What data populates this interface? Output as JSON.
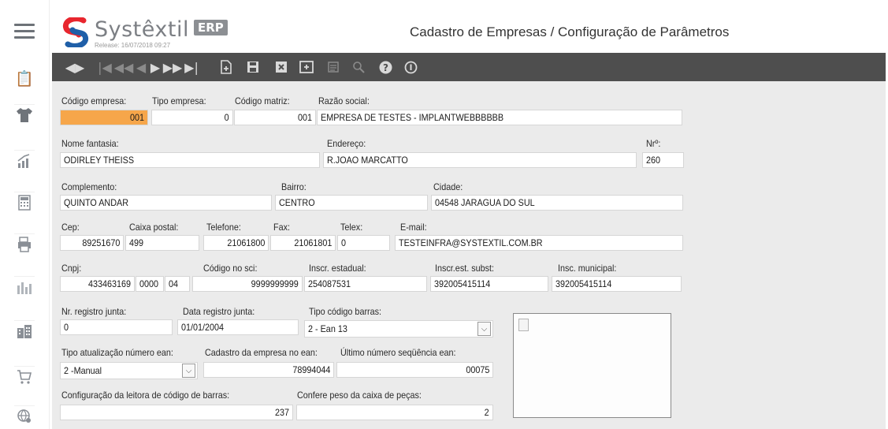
{
  "app": {
    "logo_text": "Systêxtil",
    "logo_badge": "ERP",
    "release": "Release: 16/07/2018 09:27",
    "page_title": "Cadastro de Empresas / Configuração de Parâmetros"
  },
  "sidebar": {
    "icons": [
      "menu-icon",
      "clipboard-icon",
      "shirt-icon",
      "chart-icon",
      "calculator-icon",
      "printer-icon",
      "factory-chart-icon",
      "buildings-icon",
      "cart-icon",
      "globe-settings-icon"
    ]
  },
  "toolbar": {
    "icons": [
      "prev-next-icon",
      "first-record-icon",
      "fast-rewind-icon",
      "prev-record-icon",
      "next-record-icon",
      "fast-forward-icon",
      "last-record-icon",
      "new-record-icon",
      "save-icon",
      "delete-icon",
      "copy-icon",
      "report-icon",
      "search-icon",
      "help-icon",
      "info-icon"
    ]
  },
  "form": {
    "codigo_empresa": {
      "label": "Código empresa:",
      "value": "001"
    },
    "tipo_empresa": {
      "label": "Tipo empresa:",
      "value": "0"
    },
    "codigo_matriz": {
      "label": "Código matriz:",
      "value": "001"
    },
    "razao_social": {
      "label": "Razão social:",
      "value": "EMPRESA DE TESTES - IMPLANTWEBBBBBB"
    },
    "nome_fantasia": {
      "label": "Nome fantasia:",
      "value": "ODIRLEY THEISS"
    },
    "endereco": {
      "label": "Endereço:",
      "value": "R.JOAO MARCATTO"
    },
    "numero": {
      "label": "Nrº:",
      "value": "260"
    },
    "complemento": {
      "label": "Complemento:",
      "value": "QUINTO ANDAR"
    },
    "bairro": {
      "label": "Bairro:",
      "value": "CENTRO"
    },
    "cidade": {
      "label": "Cidade:",
      "code": "04548",
      "value": "JARAGUA DO SUL"
    },
    "cep": {
      "label": "Cep:",
      "value": "89251670"
    },
    "caixa_postal": {
      "label": "Caixa postal:",
      "value": "499"
    },
    "telefone": {
      "label": "Telefone:",
      "value": "21061800"
    },
    "fax": {
      "label": "Fax:",
      "value": "21061801"
    },
    "telex": {
      "label": "Telex:",
      "value": "0"
    },
    "email": {
      "label": "E-mail:",
      "value": "TESTEINFRA@SYSTEXTIL.COM.BR"
    },
    "cnpj": {
      "label": "Cnpj:",
      "part1": "433463169",
      "part2": "0000",
      "part3": "04"
    },
    "codigo_sci": {
      "label": "Código no sci:",
      "value": "9999999999"
    },
    "inscr_estadual": {
      "label": "Inscr. estadual:",
      "value": "254087531"
    },
    "inscr_est_subst": {
      "label": "Inscr.est. subst:",
      "value": "392005415114"
    },
    "insc_municipal": {
      "label": "Insc. municipal:",
      "value": "392005415114"
    },
    "nr_registro_junta": {
      "label": "Nr. registro junta:",
      "value": "0"
    },
    "data_registro_junta": {
      "label": "Data registro junta:",
      "value": "01/01/2004"
    },
    "tipo_codigo_barras": {
      "label": "Tipo código barras:",
      "value": "2 - Ean 13"
    },
    "tipo_atualizacao_ean": {
      "label": "Tipo atualização número ean:",
      "value": "2 -Manual"
    },
    "cadastro_empresa_ean": {
      "label": "Cadastro da empresa no ean:",
      "value": "78994044"
    },
    "ultimo_numero_ean": {
      "label": "Último número seqüência ean:",
      "value": "00075"
    },
    "config_leitora": {
      "label": "Configuração da leitora de código de barras:",
      "value": "237"
    },
    "confere_peso": {
      "label": "Confere peso da caixa de peças:",
      "value": "2"
    }
  },
  "colors": {
    "toolbar_bg": "#4e4e4e",
    "form_bg": "#ebebeb",
    "highlight": "#f6a64a",
    "logo_red": "#e8262e",
    "logo_blue": "#1f5fa8"
  }
}
